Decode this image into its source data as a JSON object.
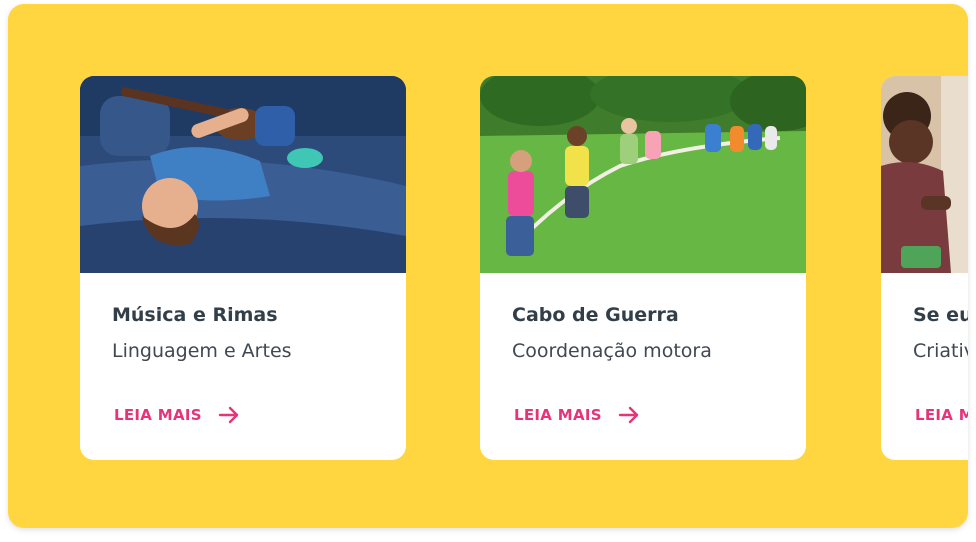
{
  "cards": [
    {
      "title": "Música e Rimas",
      "subtitle": "Linguagem e Artes",
      "link_label": "LEIA MAIS",
      "image": "child-lying-on-blue-sofa-playing-ukulele",
      "link_icon": "arrow-right-icon"
    },
    {
      "title": "Cabo de Guerra",
      "subtitle": "Coordenação motora",
      "link_label": "LEIA MAIS",
      "image": "children-playing-tug-of-war-on-grass",
      "link_icon": "arrow-right-icon"
    },
    {
      "title": "Se eu",
      "subtitle": "Criativ",
      "link_label": "LEIA M",
      "image": "child-playing-with-toys",
      "link_icon": "arrow-right-icon"
    }
  ],
  "colors": {
    "background": "#FFD63F",
    "card": "#FFFFFF",
    "accent": "#E7337A",
    "title_text": "#333F48"
  }
}
